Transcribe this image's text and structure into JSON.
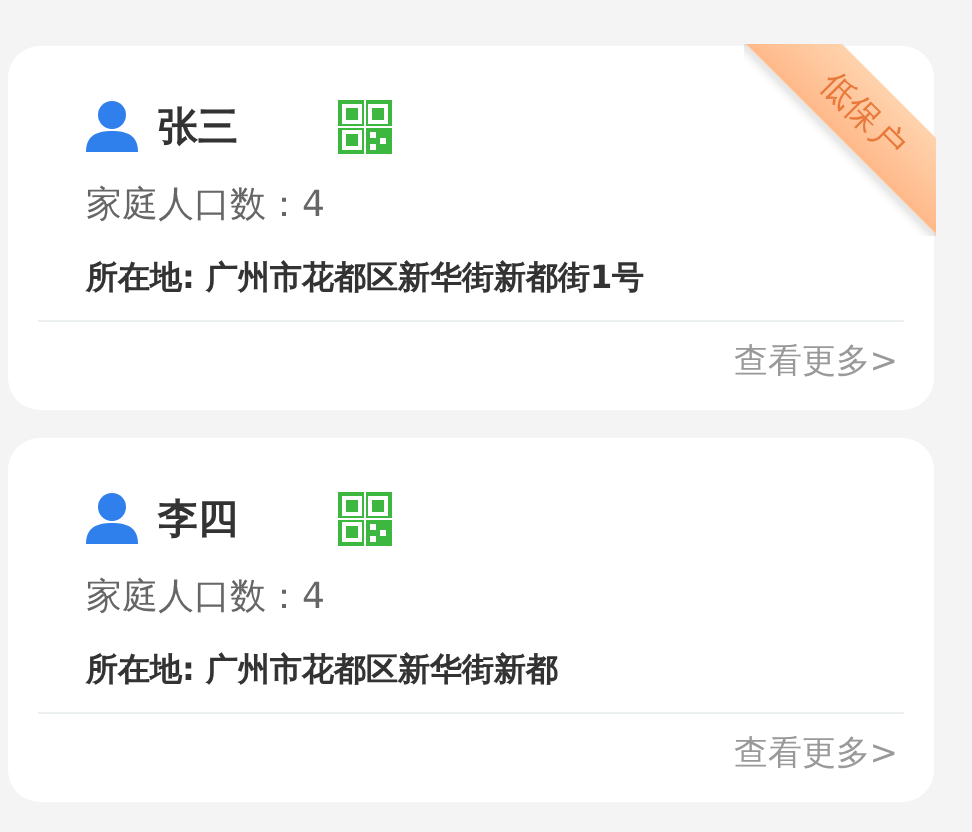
{
  "cards": [
    {
      "name": "张三",
      "household": "家庭人口数：4",
      "address": "所在地: 广州市花都区新华街新都街1号",
      "ribbon": "低保户",
      "more": "查看更多>"
    },
    {
      "name": "李四",
      "household": "家庭人口数：4",
      "address": "所在地: 广州市花都区新华街新都",
      "more": "查看更多>"
    }
  ]
}
